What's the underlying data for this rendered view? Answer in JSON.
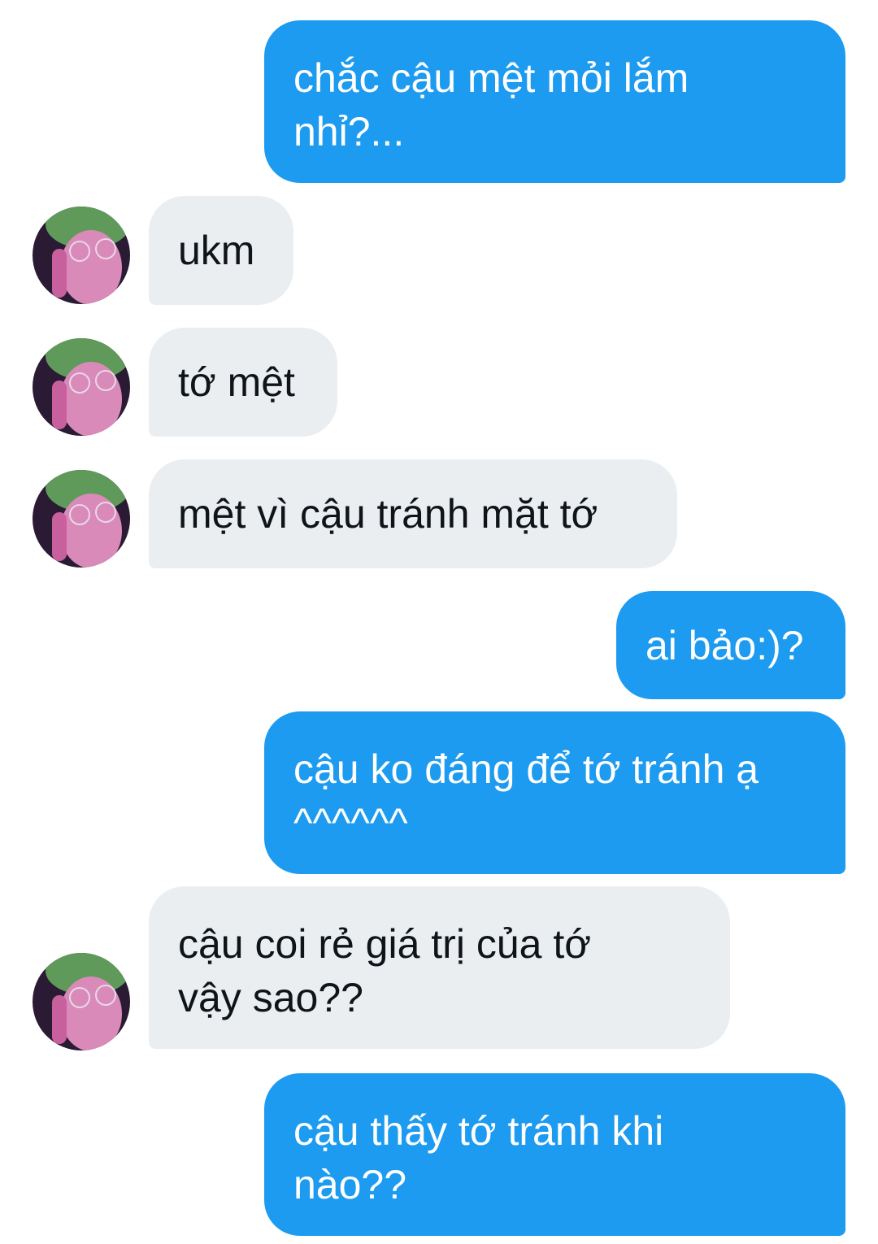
{
  "messages": [
    {
      "from": "me",
      "text": "chắc cậu mệt mỏi lắm\nnhỉ?..."
    },
    {
      "from": "them",
      "text": "ukm"
    },
    {
      "from": "them",
      "text": "tớ mệt"
    },
    {
      "from": "them",
      "text": "mệt vì cậu tránh mặt tớ"
    },
    {
      "from": "me",
      "text": "ai bảo:)?"
    },
    {
      "from": "me",
      "text": "cậu ko đáng để tớ tránh ạ\n^^^^^^"
    },
    {
      "from": "them",
      "text": "cậu coi rẻ giá trị của tớ\nvậy sao??"
    },
    {
      "from": "me",
      "text": "cậu thấy tớ tránh khi\nnào??"
    }
  ],
  "contact": {
    "avatar_icon": "person-avatar-icon"
  },
  "colors": {
    "sent_bubble": "#1d9bf0",
    "received_bubble": "#ebeef0",
    "sent_text": "#ffffff",
    "received_text": "#0f1419"
  }
}
